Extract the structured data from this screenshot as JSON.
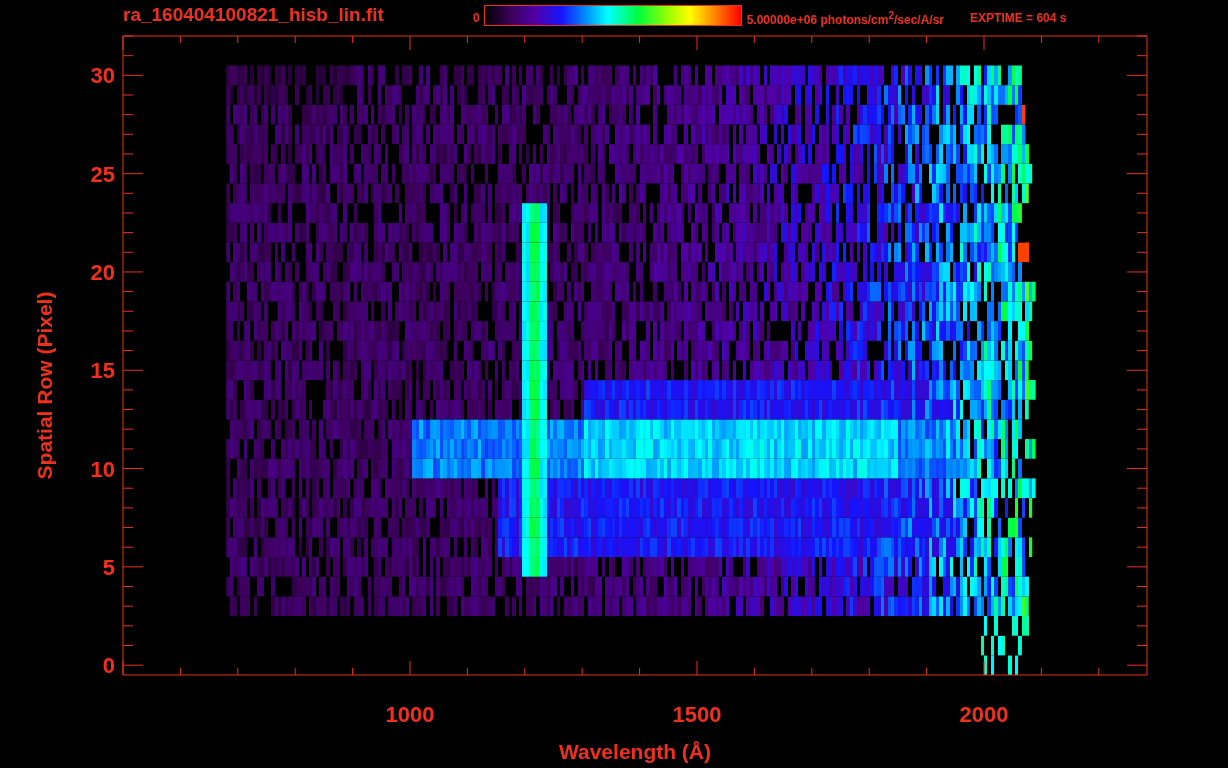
{
  "title": "ra_160404100821_hisb_lin.fit",
  "colorbar": {
    "min_label": "0",
    "max_label": "5.00000e+06 photons/cm$^{2}$/sec/A/sr"
  },
  "exposure": "EXPTIME = 604 s",
  "plot": {
    "xlabel": "Wavelength (Å)",
    "ylabel": "Spatial Row (Pixel)",
    "xticks": [
      "1000",
      "1500",
      "2000"
    ],
    "yticks": [
      "30",
      "25",
      "20",
      "15",
      "10",
      "5",
      "0"
    ]
  }
}
